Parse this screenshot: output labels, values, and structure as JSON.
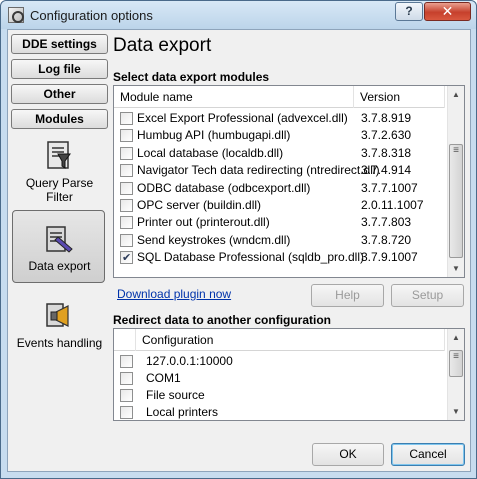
{
  "window": {
    "title": "Configuration options",
    "help_glyph": "?",
    "close_glyph": "✕"
  },
  "nav": {
    "buttons": [
      "DDE settings",
      "Log file",
      "Other",
      "Modules"
    ],
    "items": [
      {
        "label": "Query Parse Filter",
        "icon": "query-parse-filter-icon"
      },
      {
        "label": "Data export",
        "icon": "data-export-icon",
        "selected": true
      },
      {
        "label": "Events handling",
        "icon": "events-handling-icon"
      }
    ]
  },
  "page": {
    "heading": "Data export",
    "modules_section_title": "Select data export modules",
    "modules_columns": [
      "Module name",
      "Version"
    ],
    "modules": [
      {
        "name": "Excel Export Professional (advexcel.dll)",
        "version": "3.7.8.919",
        "checked": false
      },
      {
        "name": "Humbug API (humbugapi.dll)",
        "version": "3.7.2.630",
        "checked": false
      },
      {
        "name": "Local database (localdb.dll)",
        "version": "3.7.8.318",
        "checked": false
      },
      {
        "name": "Navigator Tech data redirecting (ntredirect.dll)",
        "version": "3.7.4.914",
        "checked": false
      },
      {
        "name": "ODBC database (odbcexport.dll)",
        "version": "3.7.7.1007",
        "checked": false
      },
      {
        "name": "OPC server (buildin.dll)",
        "version": "2.0.11.1007",
        "checked": false
      },
      {
        "name": "Printer out (printerout.dll)",
        "version": "3.7.7.803",
        "checked": false
      },
      {
        "name": "Send keystrokes (wndcm.dll)",
        "version": "3.7.8.720",
        "checked": false
      },
      {
        "name": "SQL Database Professional (sqldb_pro.dll)",
        "version": "3.7.9.1007",
        "checked": true
      }
    ],
    "download_link": "Download plugin now",
    "help_button": "Help",
    "setup_button": "Setup",
    "redirect_section_title": "Redirect data to another configuration",
    "redirect_column": "Configuration",
    "redirect_items": [
      {
        "name": "127.0.0.1:10000",
        "checked": false
      },
      {
        "name": "COM1",
        "checked": false
      },
      {
        "name": "File source",
        "checked": false
      },
      {
        "name": "Local printers",
        "checked": false
      }
    ]
  },
  "footer": {
    "ok_button": "OK",
    "cancel_button": "Cancel"
  }
}
